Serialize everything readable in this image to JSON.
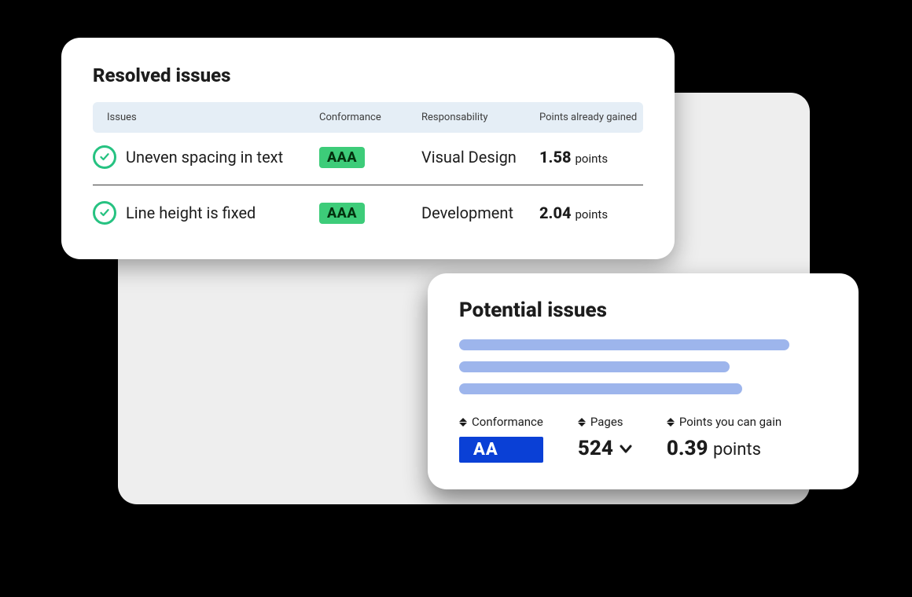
{
  "resolved": {
    "title": "Resolved issues",
    "headers": {
      "issues": "Issues",
      "conformance": "Conformance",
      "responsability": "Responsability",
      "points": "Points already gained"
    },
    "rows": [
      {
        "issue": "Uneven spacing in text",
        "conformance": "AAA",
        "responsability": "Visual Design",
        "points_value": "1.58",
        "points_unit": "points"
      },
      {
        "issue": "Line height is fixed",
        "conformance": "AAA",
        "responsability": "Development",
        "points_value": "2.04",
        "points_unit": "points"
      }
    ]
  },
  "potential": {
    "title": "Potential issues",
    "columns": {
      "conformance_label": "Conformance",
      "pages_label": "Pages",
      "points_label": "Points you can gain"
    },
    "conformance_badge": "AA",
    "pages_value": "524",
    "gain_value": "0.39",
    "gain_unit": "points"
  }
}
